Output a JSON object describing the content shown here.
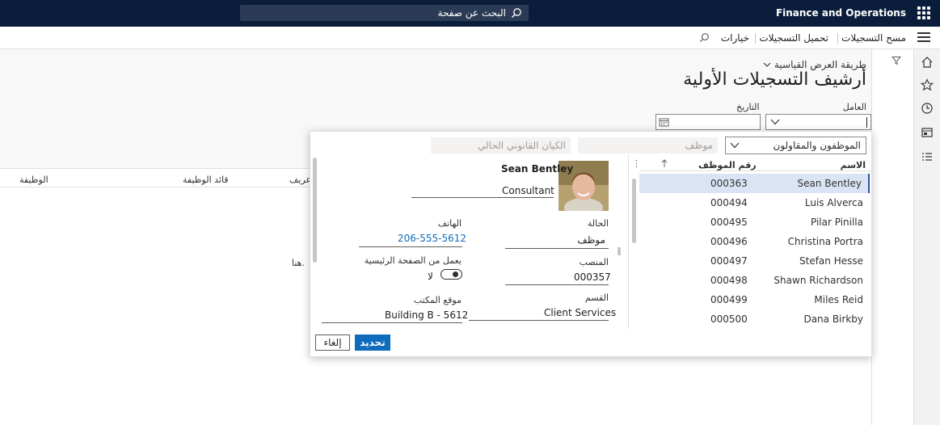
{
  "topbar": {
    "app_title": "Finance and Operations",
    "search_placeholder": "البحث عن صفحة"
  },
  "actionbar": {
    "items": [
      "مسح التسجيلات",
      "تحميل التسجيلات",
      "خيارات"
    ]
  },
  "page": {
    "view_label": "طريقة العرض القياسية",
    "title": "أرشيف التسجيلات الأولية"
  },
  "filters": {
    "worker_label": "العامل",
    "date_label": "التاريخ",
    "worker_value": "",
    "date_value": ""
  },
  "grid": {
    "headers": [
      "عريف",
      "قائد الوظيفة",
      "الوظيفة"
    ],
    "empty_text": "هنا."
  },
  "lookup": {
    "type_dropdown": "الموظفون والمقاولون",
    "employee_field": "موظف",
    "legal_entity_field": "الكيان القانوني الحالي",
    "list_headers": {
      "name": "الاسم",
      "id": "رقم الموظف"
    },
    "rows": [
      {
        "name": "Sean Bentley",
        "id": "000363",
        "selected": true
      },
      {
        "name": "Luis Alverca",
        "id": "000494",
        "selected": false
      },
      {
        "name": "Pilar Pinilla",
        "id": "000495",
        "selected": false
      },
      {
        "name": "Christina Portra",
        "id": "000496",
        "selected": false
      },
      {
        "name": "Stefan Hesse",
        "id": "000497",
        "selected": false
      },
      {
        "name": "Shawn Richardson",
        "id": "000498",
        "selected": false
      },
      {
        "name": "Miles Reid",
        "id": "000499",
        "selected": false
      },
      {
        "name": "Dana Birkby",
        "id": "000500",
        "selected": false
      }
    ],
    "card": {
      "name": "Sean Bentley",
      "title": "Consultant",
      "status_label": "الحالة",
      "status": "موظف",
      "phone_label": "الهاتف",
      "phone": "206-555-5612",
      "position_label": "المنصب",
      "position": "000357",
      "remote_label": "يعمل من الصفحة الرئيسية",
      "remote_value": "لا",
      "department_label": "القسم",
      "department": "Client Services",
      "office_label": "موقع المكتب",
      "office": "Building B - 5612"
    },
    "select_button": "تحديد",
    "cancel_button": "إلغاء"
  },
  "colors": {
    "topbar": "#0a1e3c",
    "accent": "#0f6cbd",
    "selected_row": "#dbe4f5"
  }
}
